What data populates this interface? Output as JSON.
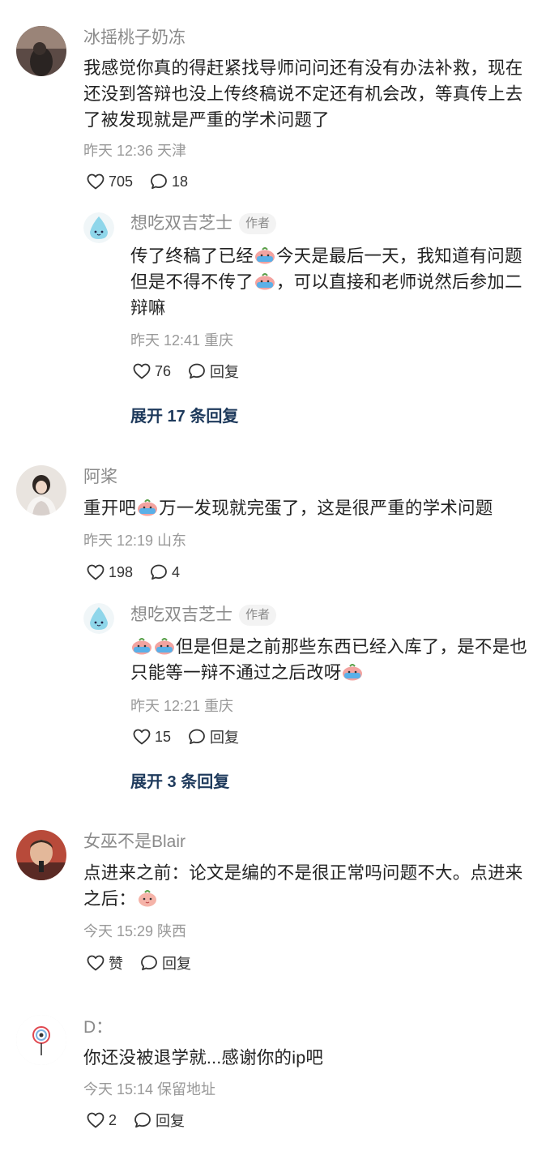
{
  "comments": [
    {
      "username": "冰摇桃子奶冻",
      "text": "我感觉你真的得赶紧找导师问问还有没有办法补救，现在还没到答辩也没上传终稿说不定还有机会改，等真传上去了被发现就是严重的学术问题了",
      "time": "昨天 12:36 天津",
      "likes": "705",
      "replies": "18",
      "reply": {
        "username": "想吃双吉芝士",
        "badge": "作者",
        "text_a": "传了终稿了已经",
        "text_b": "今天是最后一天，我知道有问题但是不得不传了",
        "text_c": "，可以直接和老师说然后参加二辩嘛",
        "time": "昨天 12:41 重庆",
        "likes": "76",
        "reply_label": "回复"
      },
      "expand": "展开 17 条回复"
    },
    {
      "username": "阿桨",
      "text_a": "重开吧",
      "text_b": "万一发现就完蛋了，这是很严重的学术问题",
      "time": "昨天 12:19 山东",
      "likes": "198",
      "replies": "4",
      "reply": {
        "username": "想吃双吉芝士",
        "badge": "作者",
        "text_a": "但是但是之前那些东西已经入库了，是不是也只能等一辩不通过之后改呀",
        "time": "昨天 12:21 重庆",
        "likes": "15",
        "reply_label": "回复"
      },
      "expand": "展开 3 条回复"
    },
    {
      "username": "女巫不是Blair",
      "text": "点进来之前：论文是编的不是很正常吗问题不大。点进来之后：",
      "time": "今天 15:29 陕西",
      "like_label": "赞",
      "reply_label": "回复"
    },
    {
      "username": "D：",
      "text": "你还没被退学就...感谢你的ip吧",
      "time": "今天 15:14 保留地址",
      "likes": "2",
      "reply_label": "回复"
    }
  ]
}
